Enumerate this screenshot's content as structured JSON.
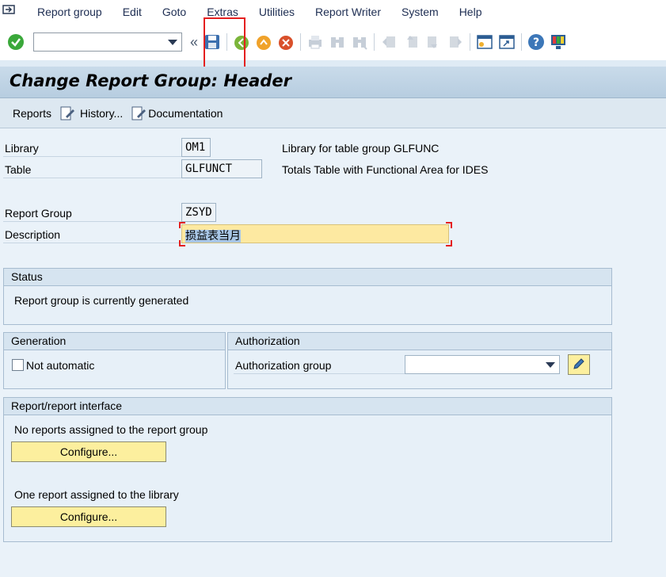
{
  "menu": [
    "Report group",
    "Edit",
    "Goto",
    "Extras",
    "Utilities",
    "Report Writer",
    "System",
    "Help"
  ],
  "toolbar": {
    "command_value": "",
    "icons": [
      "enter-icon",
      "save-icon",
      "back-icon",
      "exit-icon",
      "cancel-icon",
      "print-icon",
      "find-icon",
      "find-next-icon",
      "first-page-icon",
      "prev-page-icon",
      "next-page-icon",
      "last-page-icon",
      "new-session-icon",
      "shortcut-icon",
      "help-icon",
      "layout-icon"
    ]
  },
  "title": "Change Report Group: Header",
  "app_toolbar": {
    "reports": "Reports",
    "history": "History...",
    "documentation": "Documentation"
  },
  "fields": {
    "library_label": "Library",
    "library_value": "OM1",
    "library_desc": "Library for table group GLFUNC",
    "table_label": "Table",
    "table_value": "GLFUNCT",
    "table_desc": "Totals Table with Functional Area for IDES",
    "report_group_label": "Report Group",
    "report_group_value": "ZSYD",
    "description_label": "Description",
    "description_value": "损益表当月"
  },
  "status": {
    "heading": "Status",
    "text": "Report group is currently generated"
  },
  "generation": {
    "heading": "Generation",
    "checkbox_label": "Not automatic",
    "checked": false
  },
  "authorization": {
    "heading": "Authorization",
    "label": "Authorization group",
    "value": ""
  },
  "interface": {
    "heading": "Report/report interface",
    "text1": "No reports assigned to the report group",
    "button1": "Configure...",
    "text2": "One report assigned to the library",
    "button2": "Configure..."
  }
}
